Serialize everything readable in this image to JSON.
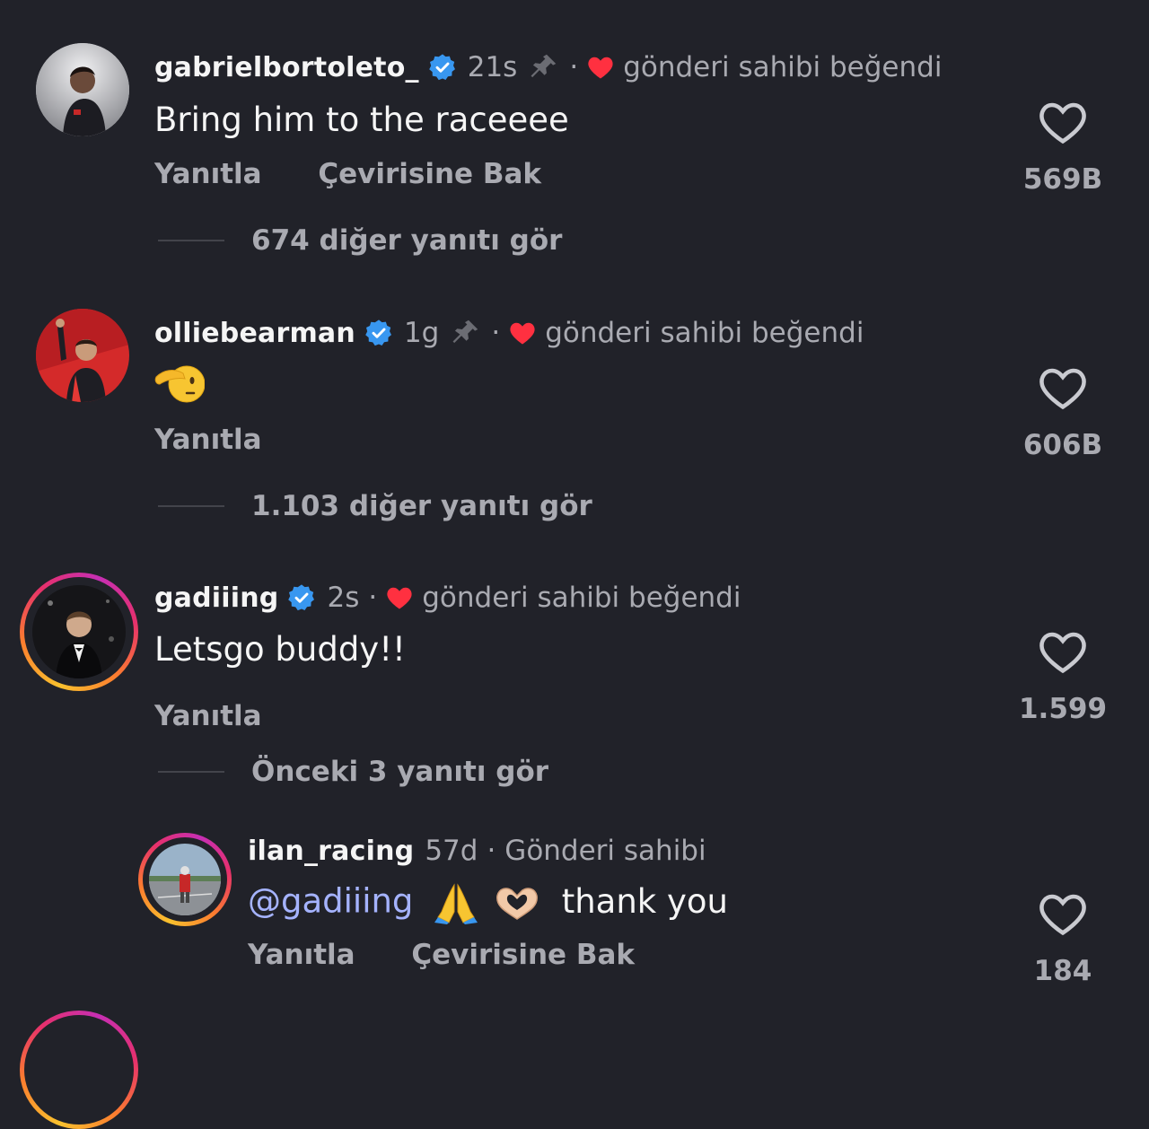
{
  "comments": [
    {
      "username": "gabrielbortoleto_",
      "time": "21s",
      "dot": "·",
      "liked_by_author": "gönderi sahibi beğendi",
      "text": "Bring him to the raceeee",
      "reply": "Yanıtla",
      "translate": "Çevirisine Bak",
      "like_count": "569B",
      "more_replies": "674 diğer yanıtı gör"
    },
    {
      "username": "olliebearman",
      "time": "1g",
      "dot": "·",
      "liked_by_author": "gönderi sahibi beğendi",
      "text": "🫡",
      "reply": "Yanıtla",
      "like_count": "606B",
      "more_replies": "1.103 diğer yanıtı gör"
    },
    {
      "username": "gadiiing",
      "time": "2s",
      "dot": "·",
      "liked_by_author": "gönderi sahibi beğendi",
      "text": "Letsgo buddy!!",
      "reply": "Yanıtla",
      "like_count": "1.599",
      "more_replies": "Önceki 3 yanıtı gör"
    },
    {
      "username": "ilan_racing",
      "time": "57d",
      "dot": "·",
      "author_label": "Gönderi sahibi",
      "mention": "@gadiiing",
      "text": "thank you",
      "reply": "Yanıtla",
      "translate": "Çevirisine Bak",
      "like_count": "184"
    }
  ],
  "icons": {
    "verified": "verified-badge-icon",
    "pin": "pin-icon",
    "heart_filled": "heart-filled-icon",
    "heart_outline": "heart-outline-icon"
  },
  "colors": {
    "background": "#212229",
    "verified": "#3897f0",
    "heart": "#ff3040",
    "mention": "#a5b3ff",
    "muted": "#a9aab1"
  }
}
